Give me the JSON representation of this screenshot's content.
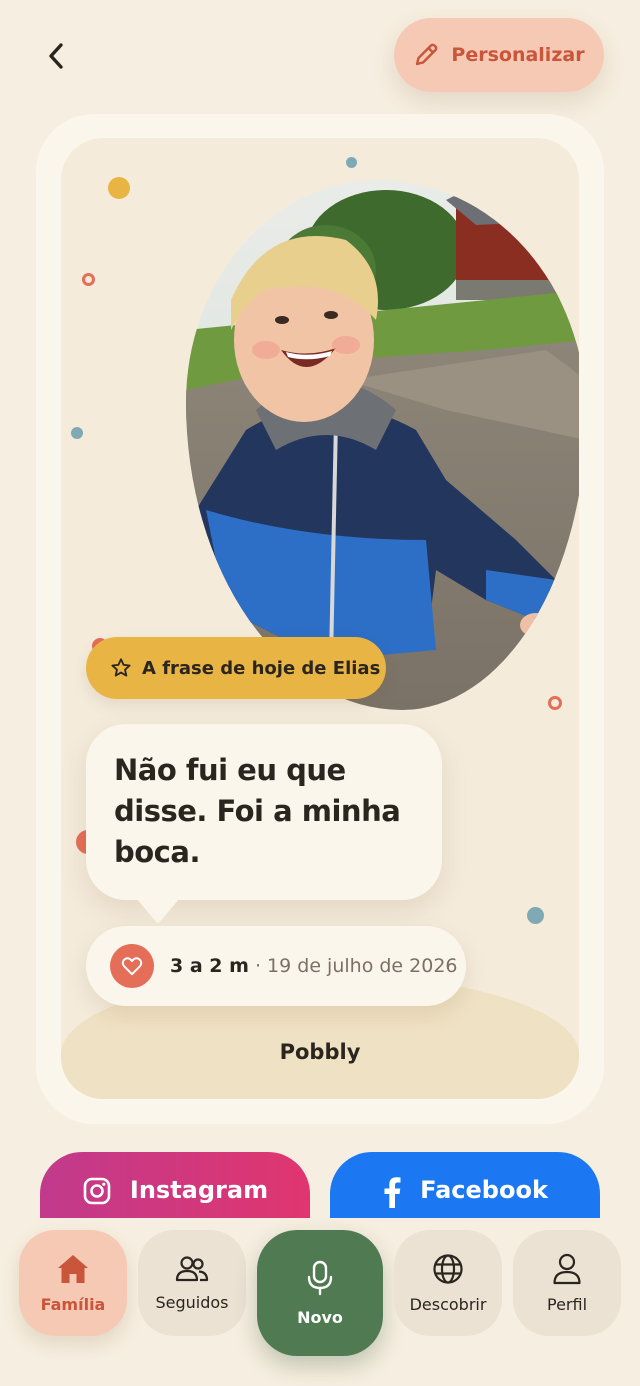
{
  "header": {
    "back_icon": "chevron-left-icon",
    "personalize_label": "Personalizar",
    "personalize_icon": "pencil-icon"
  },
  "card": {
    "photo_description_icon": "child-photo",
    "phrase_label": "A frase de hoje de Elias",
    "phrase_icon": "star-icon",
    "quote": "Não fui eu que disse. Foi a minha boca.",
    "age": "3 a 2 m",
    "separator": "·",
    "date": "19 de julho de 2026",
    "heart_icon": "heart-icon",
    "brand": "Pobbly"
  },
  "share": {
    "instagram_label": "Instagram",
    "facebook_label": "Facebook"
  },
  "nav": {
    "items": [
      {
        "label": "Família",
        "icon": "home-icon",
        "active": true
      },
      {
        "label": "Seguidos",
        "icon": "users-icon",
        "active": false
      },
      {
        "label": "Novo",
        "icon": "microphone-icon",
        "active": false
      },
      {
        "label": "Descobrir",
        "icon": "globe-icon",
        "active": false
      },
      {
        "label": "Perfil",
        "icon": "user-icon",
        "active": false
      }
    ]
  },
  "colors": {
    "background": "#f6eee0",
    "accent_coral": "#e46e57",
    "pill_yellow": "#e8b544",
    "nav_green": "#4f7a52",
    "instagram": "#d8367a",
    "facebook": "#1b78f2"
  }
}
